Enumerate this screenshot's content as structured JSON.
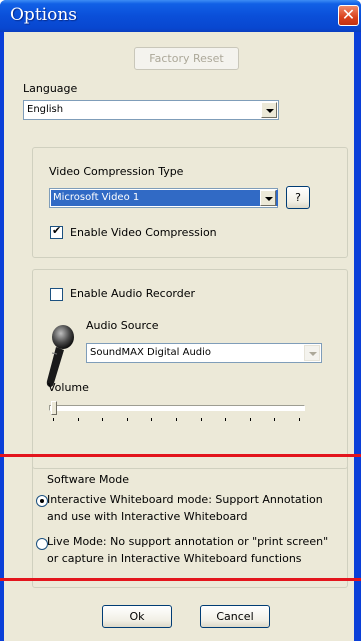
{
  "window": {
    "title": "Options"
  },
  "factory_reset": {
    "label": "Factory Reset"
  },
  "language": {
    "label": "Language",
    "value": "English"
  },
  "video": {
    "compression_type_label": "Video Compression Type",
    "compression_value": "Microsoft Video 1",
    "help_label": "?",
    "enable_label": "Enable Video Compression",
    "enable_checked": true
  },
  "audio": {
    "enable_label": "Enable Audio Recorder",
    "enable_checked": false,
    "source_label": "Audio Source",
    "source_value": "SoundMAX Digital Audio",
    "volume_label": "Volume",
    "volume_level": 0
  },
  "software_mode": {
    "heading": "Software Mode",
    "options": [
      {
        "line1": "Interactive Whiteboard mode: Support Annotation",
        "line2": "and use with Interactive Whiteboard",
        "selected": true
      },
      {
        "line1": "Live Mode: No support annotation or \"print screen\"",
        "line2": "or capture in Interactive Whiteboard functions",
        "selected": false
      }
    ]
  },
  "footer": {
    "ok_label": "Ok",
    "cancel_label": "Cancel"
  },
  "icons": {
    "close": "close-icon",
    "microphone": "microphone-icon"
  },
  "colors": {
    "titlebar": "#0a4fd9",
    "highlight": "#e3151d",
    "selection": "#316ac5"
  }
}
